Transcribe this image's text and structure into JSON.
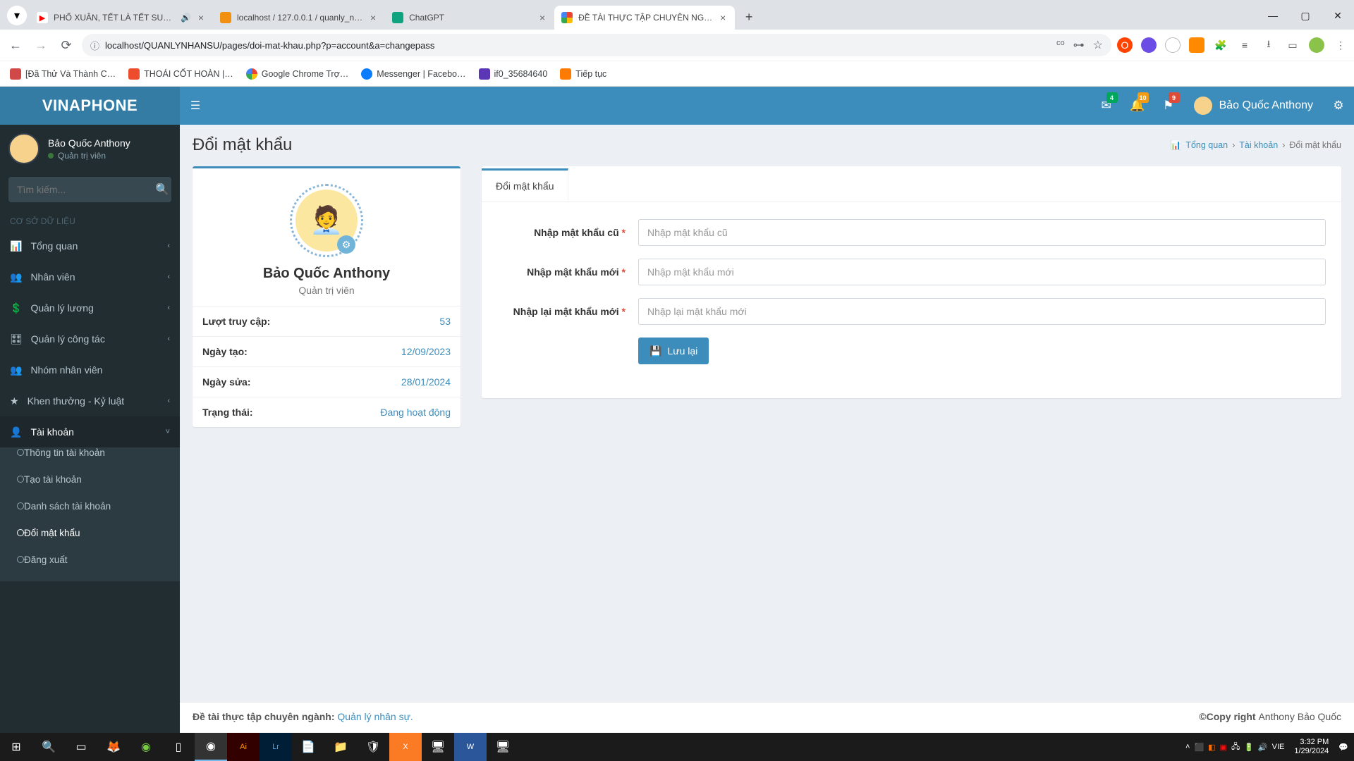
{
  "browser": {
    "tabs": [
      {
        "title": "PHỐ XUÂN, TẾT LÀ TẾT SUM…",
        "favicon": "yt",
        "audio": true
      },
      {
        "title": "localhost / 127.0.0.1 / quanly_n…",
        "favicon": "pma"
      },
      {
        "title": "ChatGPT",
        "favicon": "gpt"
      },
      {
        "title": "ĐỀ TÀI THỰC TẬP CHUYÊN NG…",
        "favicon": "circle",
        "active": true
      }
    ],
    "url": "localhost/QUANLYNHANSU/pages/doi-mat-khau.php?p=account&a=changepass",
    "bookmarks": [
      {
        "label": "[Đã Thử Và Thành C…",
        "color": "#d14848"
      },
      {
        "label": "THOÁI CỐT HOÀN |…",
        "color": "#ee4d2d"
      },
      {
        "label": "Google Chrome Trợ…",
        "color": "#4285f4"
      },
      {
        "label": "Messenger | Facebo…",
        "color": "#0a7cff"
      },
      {
        "label": "if0_35684640",
        "color": "#5b37b6"
      },
      {
        "label": "Tiếp tục",
        "color": "#ff7a00"
      }
    ]
  },
  "brand": "VINAPHONE",
  "topbar": {
    "mail_badge": "4",
    "bell_badge": "10",
    "flag_badge": "9",
    "user": "Bảo Quốc Anthony"
  },
  "sidebar": {
    "user": {
      "name": "Bảo Quốc Anthony",
      "role": "Quản trị viên"
    },
    "search_placeholder": "Tìm kiếm...",
    "header": "CƠ SỞ DỮ LIỆU",
    "menu": [
      {
        "label": "Tổng quan"
      },
      {
        "label": "Nhân viên"
      },
      {
        "label": "Quản lý lương"
      },
      {
        "label": "Quản lý công tác"
      },
      {
        "label": "Nhóm nhân viên"
      },
      {
        "label": "Khen thưởng - Kỷ luật"
      },
      {
        "label": "Tài khoản",
        "active": true
      }
    ],
    "submenu": [
      {
        "label": "Thông tin tài khoản"
      },
      {
        "label": "Tạo tài khoản"
      },
      {
        "label": "Danh sách tài khoản"
      },
      {
        "label": "Đổi mật khẩu",
        "active": true
      },
      {
        "label": "Đăng xuất"
      }
    ]
  },
  "page": {
    "title": "Đổi mật khẩu",
    "breadcrumb": {
      "home": "Tổng quan",
      "mid": "Tài khoản",
      "leaf": "Đổi mật khẩu"
    }
  },
  "profile": {
    "name": "Bảo Quốc Anthony",
    "role": "Quản trị viên",
    "rows": [
      {
        "k": "Lượt truy cập:",
        "v": "53"
      },
      {
        "k": "Ngày tạo:",
        "v": "12/09/2023"
      },
      {
        "k": "Ngày sửa:",
        "v": "28/01/2024"
      },
      {
        "k": "Trạng thái:",
        "v": "Đang hoạt động"
      }
    ]
  },
  "form": {
    "tab": "Đổi mật khẩu",
    "fields": [
      {
        "label": "Nhập mật khẩu cũ",
        "placeholder": "Nhập mật khẩu cũ"
      },
      {
        "label": "Nhập mật khẩu mới",
        "placeholder": "Nhập mật khẩu mới"
      },
      {
        "label": "Nhập lại mật khẩu mới",
        "placeholder": "Nhập lại mật khẩu mới"
      }
    ],
    "save": "Lưu lại"
  },
  "footer": {
    "left_prefix": "Đề tài thực tập chuyên ngành: ",
    "left_link": "Quản lý nhân sự.",
    "right_strong": "©Copy right ",
    "right_rest": "Anthony Bảo Quốc"
  },
  "taskbar": {
    "time": "3:32 PM",
    "date": "1/29/2024",
    "lang": "VIE"
  }
}
